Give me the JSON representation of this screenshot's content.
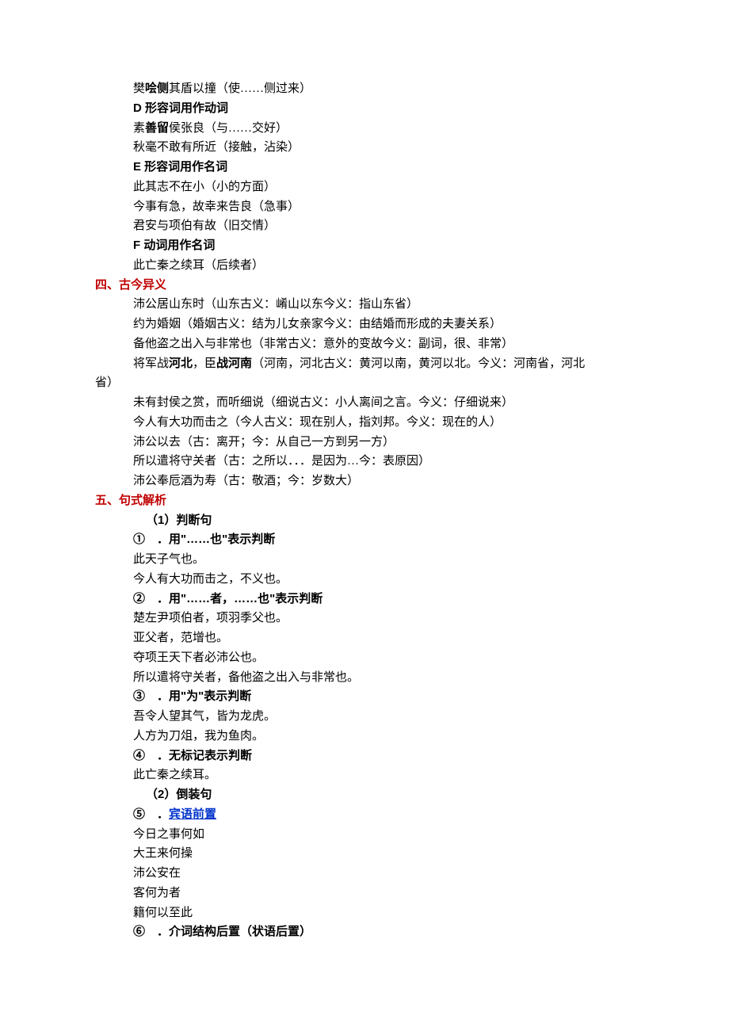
{
  "l1": "樊哙侧其盾以撞（使……侧过来）",
  "hD": "D 形容词用作动词",
  "l2": "素善留侯张良（与……交好）",
  "l3": "秋毫不敢有所近（接触，沾染）",
  "hE": "E 形容词用作名词",
  "l4": "此其志不在小（小的方面）",
  "l5": "今事有急，故幸来告良（急事）",
  "l6": "君安与项伯有故（旧交情）",
  "hF": "F 动词用作名词",
  "l7": "此亡秦之续耳（后续者）",
  "sec4": "四、古今异义",
  "l8": "沛公居山东时（山东古义：崤山以东今义：指山东省）",
  "l9": "约为婚姻（婚姻古义：结为儿女亲家今义：由结婚而形成的夫妻关系）",
  "l10": "备他盗之出入与非常也（非常古义：意外的变故今义：副词，很、非常）",
  "l11a": "将军战",
  "l11b": "河北",
  "l11c": "，臣",
  "l11d": "战河南",
  "l11e": "（河南，河北古义：黄河以南，黄河以北。今义：河南省，河北",
  "l11f": "省）",
  "l12": "未有封侯之赏，而听细说（细说古义：小人离间之言。今义：仔细说来）",
  "l13": "今人有大功而击之（今人古义：现在别人，指刘邦。今义：现在的人）",
  "l14": "沛公以去（古：离开；今：从自己一方到另一方）",
  "l15": "所以遣将守关者（古：之所以．．．是因为…今：表原因）",
  "l16": "沛公奉卮酒为寿（古：敬酒；今：岁数大）",
  "sec5": "五、句式解析",
  "h51": "（1）判断句",
  "n1": "①　．用\"……也\"表示判断",
  "l17": "此天子气也。",
  "l18": "今人有大功而击之，不义也。",
  "n2": "②　．用\"……者，……也\"表示判断",
  "l19": "楚左尹项伯者，项羽季父也。",
  "l20": "亚父者，范增也。",
  "l21": "夺项王天下者必沛公也。",
  "l22": "所以遣将守关者，备他盗之出入与非常也。",
  "n3": "③　．用\"为\"表示判断",
  "l23": "吾令人望其气，皆为龙虎。",
  "l24": "人方为刀俎，我为鱼肉。",
  "n4": "④　．无标记表示判断",
  "l25": "此亡秦之续耳。",
  "h52": "（2）倒装句",
  "n5a": "⑤　．",
  "n5b": "宾语前置",
  "l26": "今日之事何如",
  "l27": "大王来何操",
  "l28": "沛公安在",
  "l29": "客何为者",
  "l30": "籍何以至此",
  "n6": "⑥　．介词结构后置（状语后置）"
}
